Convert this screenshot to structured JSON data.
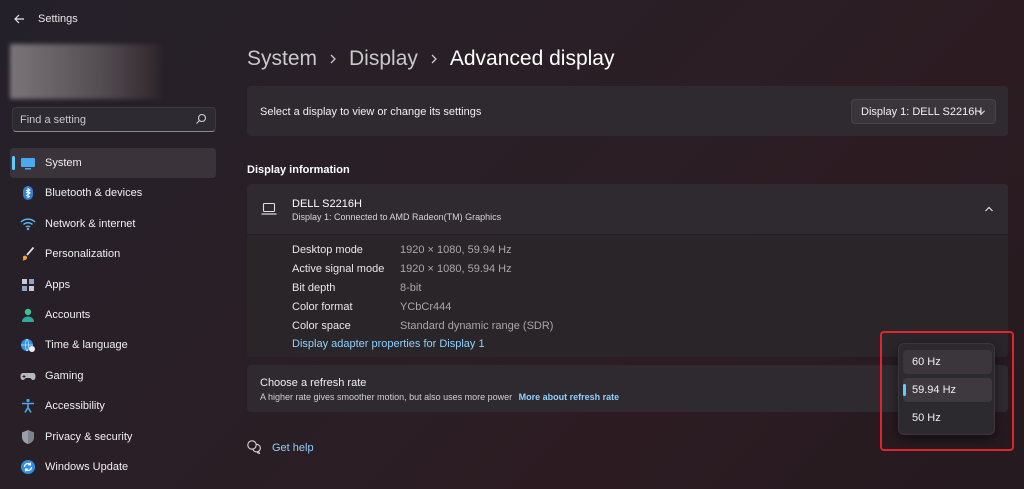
{
  "window": {
    "title": "Settings"
  },
  "search": {
    "placeholder": "Find a setting"
  },
  "sidebar": {
    "items": [
      {
        "label": "System",
        "icon": "monitor-icon",
        "active": true
      },
      {
        "label": "Bluetooth & devices",
        "icon": "bluetooth-icon"
      },
      {
        "label": "Network & internet",
        "icon": "wifi-icon"
      },
      {
        "label": "Personalization",
        "icon": "brush-icon"
      },
      {
        "label": "Apps",
        "icon": "apps-icon"
      },
      {
        "label": "Accounts",
        "icon": "person-icon"
      },
      {
        "label": "Time & language",
        "icon": "globe-clock-icon"
      },
      {
        "label": "Gaming",
        "icon": "gamepad-icon"
      },
      {
        "label": "Accessibility",
        "icon": "accessibility-icon"
      },
      {
        "label": "Privacy & security",
        "icon": "shield-icon"
      },
      {
        "label": "Windows Update",
        "icon": "update-icon"
      }
    ]
  },
  "breadcrumb": {
    "items": [
      "System",
      "Display"
    ],
    "current": "Advanced display"
  },
  "display_select": {
    "label": "Select a display to view or change its settings",
    "value": "Display 1: DELL S2216H"
  },
  "display_info": {
    "section_title": "Display information",
    "monitor_name": "DELL S2216H",
    "monitor_sub": "Display 1: Connected to AMD Radeon(TM) Graphics",
    "rows": [
      {
        "key": "Desktop mode",
        "value": "1920 × 1080, 59.94 Hz"
      },
      {
        "key": "Active signal mode",
        "value": "1920 × 1080, 59.94 Hz"
      },
      {
        "key": "Bit depth",
        "value": "8-bit"
      },
      {
        "key": "Color format",
        "value": "YCbCr444"
      },
      {
        "key": "Color space",
        "value": "Standard dynamic range (SDR)"
      }
    ],
    "adapter_link": "Display adapter properties for Display 1"
  },
  "refresh_rate": {
    "title": "Choose a refresh rate",
    "description": "A higher rate gives smoother motion, but also uses more power",
    "link": "More about refresh rate",
    "options": [
      "60 Hz",
      "59.94 Hz",
      "50 Hz"
    ],
    "selected": "59.94 Hz"
  },
  "help": {
    "label": "Get help"
  },
  "colors": {
    "accent": "#60cdff",
    "link": "#8fd0ff",
    "highlight": "#e0262a"
  }
}
